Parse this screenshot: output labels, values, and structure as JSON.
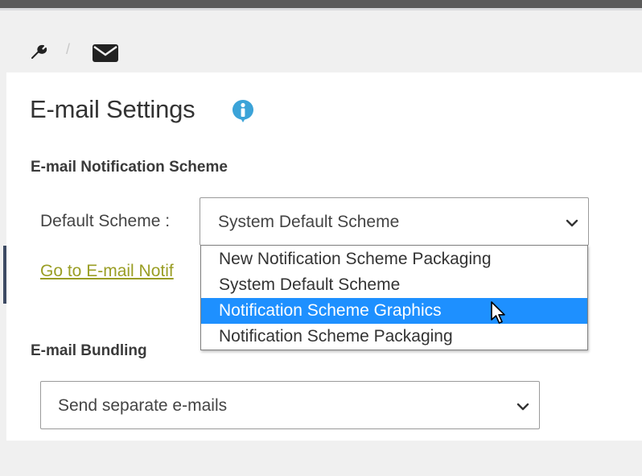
{
  "breadcrumb": {
    "items": [
      {
        "icon": "wrench-icon"
      },
      {
        "icon": "envelope-icon"
      }
    ],
    "separator": "/"
  },
  "page": {
    "title": "E-mail Settings",
    "info_icon": "info-icon"
  },
  "notification": {
    "section_title": "E-mail Notification Scheme",
    "default_label": "Default Scheme :",
    "selected_value": "System Default Scheme",
    "link_text": "Go to E-mail Notif",
    "options": [
      "New Notification Scheme Packaging",
      "System Default Scheme",
      "Notification Scheme Graphics",
      "Notification Scheme Packaging"
    ],
    "highlighted_option": "Notification Scheme Graphics"
  },
  "bundling": {
    "section_title": "E-mail Bundling",
    "selected_value": "Send separate e-mails"
  },
  "colors": {
    "highlight": "#1e90ff",
    "link": "#9a9e25",
    "info_icon": "#3ba3d8",
    "top_bar": "#5a5a5a"
  }
}
